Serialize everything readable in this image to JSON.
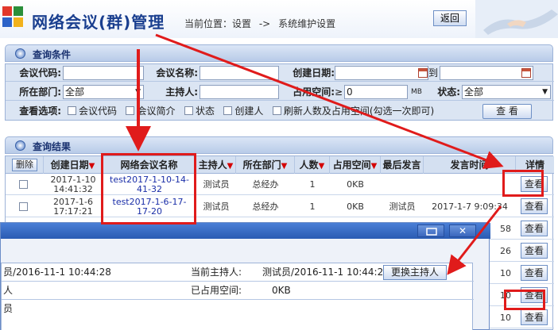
{
  "header": {
    "title": "网络会议(群)管理",
    "location_label": "当前位置：设置",
    "location_arrow": "->",
    "location_page": "系统维护设置",
    "back_label": "返回"
  },
  "query": {
    "section_title": "查询条件",
    "labels": {
      "code": "会议代码:",
      "name": "会议名称:",
      "created": "创建日期:",
      "date_to": "到",
      "dept": "所在部门:",
      "host": "主持人:",
      "space": "占用空间:",
      "status": "状态:",
      "options": "查看选项:"
    },
    "dept_value": "全部",
    "space_op": "≥",
    "space_value": "0",
    "space_unit": "MB",
    "status_value": "全部",
    "checkboxes": [
      "会议代码",
      "会议简介",
      "状态",
      "创建人",
      "刷新人数及占用空间(勾选一次即可)"
    ],
    "search_label": "查 看"
  },
  "results": {
    "section_title": "查询结果",
    "delete_label": "删除",
    "columns": [
      "创建日期",
      "网络会议名称",
      "主持人",
      "所在部门",
      "人数",
      "占用空间",
      "最后发言",
      "发言时间",
      "详情"
    ],
    "rows": [
      {
        "date": "2017-1-10",
        "time": "14:41:32",
        "name1": "test2017-1-10-14-",
        "name2": "41-32",
        "host": "测试员",
        "dept": "总经办",
        "count": "1",
        "space": "0KB",
        "last": "",
        "speak_time": "",
        "detail": "查看"
      },
      {
        "date": "2017-1-6",
        "time": "17:17:21",
        "name1": "test2017-1-6-17-",
        "name2": "17-20",
        "host": "测试员",
        "dept": "总经办",
        "count": "1",
        "space": "0KB",
        "last": "测试员",
        "speak_time": "2017-1-7 9:09:34",
        "detail": "查看"
      }
    ],
    "hidden_times": [
      "58",
      "26",
      "10",
      "10",
      "10"
    ],
    "view_label": "查看"
  },
  "dialog": {
    "row1_left": "员/2016-11-1 10:44:28",
    "current_host_label": "当前主持人:",
    "current_host_value": "测试员/2016-11-1 10:44:28",
    "change_host_label": "更换主持人",
    "row2_left": "人",
    "used_space_label": "已占用空间:",
    "used_space_value": "0KB",
    "row3_left": "员"
  },
  "colors": {
    "annotation": "#e01b1b",
    "title": "#1a3f8f",
    "link": "#1a2ea8"
  }
}
